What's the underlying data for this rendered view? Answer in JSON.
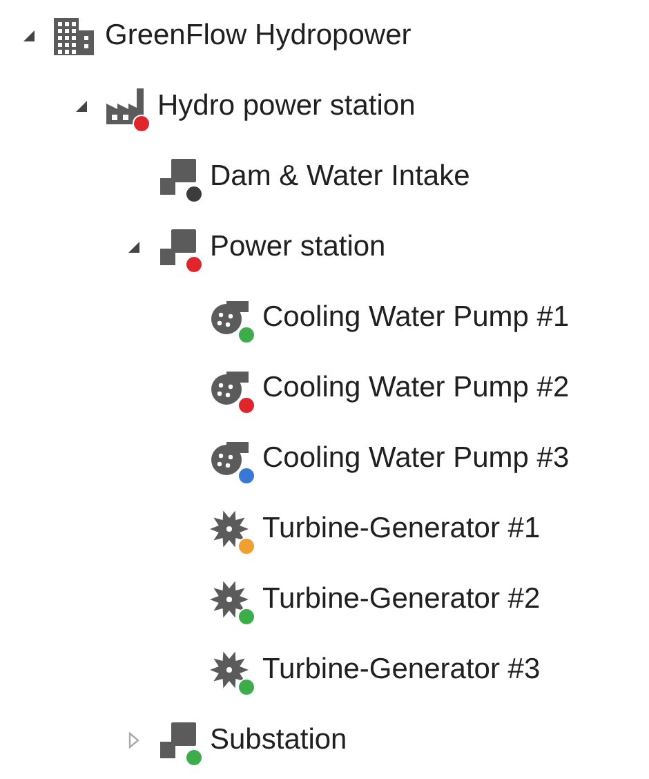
{
  "tree": [
    {
      "label": "GreenFlow Hydropower",
      "kind": "building",
      "expanded": true,
      "children": [
        {
          "label": "Hydro power station",
          "kind": "factory",
          "color": "#e0262b",
          "expanded": true,
          "children": [
            {
              "label": "Dam & Water Intake",
              "kind": "unit",
              "color": "#3c3c3c"
            },
            {
              "label": "Power station",
              "kind": "unit",
              "color": "#e0262b",
              "expanded": true,
              "children": [
                {
                  "label": "Cooling Water Pump #1",
                  "kind": "pump",
                  "color": "#3dac4b"
                },
                {
                  "label": "Cooling Water Pump #2",
                  "kind": "pump",
                  "color": "#e0262b"
                },
                {
                  "label": "Cooling Water Pump #3",
                  "kind": "pump",
                  "color": "#3a78d8"
                },
                {
                  "label": "Turbine-Generator #1",
                  "kind": "turbine",
                  "color": "#f0a030"
                },
                {
                  "label": "Turbine-Generator #2",
                  "kind": "turbine",
                  "color": "#3dac4b"
                },
                {
                  "label": "Turbine-Generator #3",
                  "kind": "turbine",
                  "color": "#3dac4b"
                }
              ]
            },
            {
              "label": "Substation",
              "kind": "unit",
              "color": "#3dac4b",
              "expanded": false
            }
          ]
        }
      ]
    }
  ]
}
